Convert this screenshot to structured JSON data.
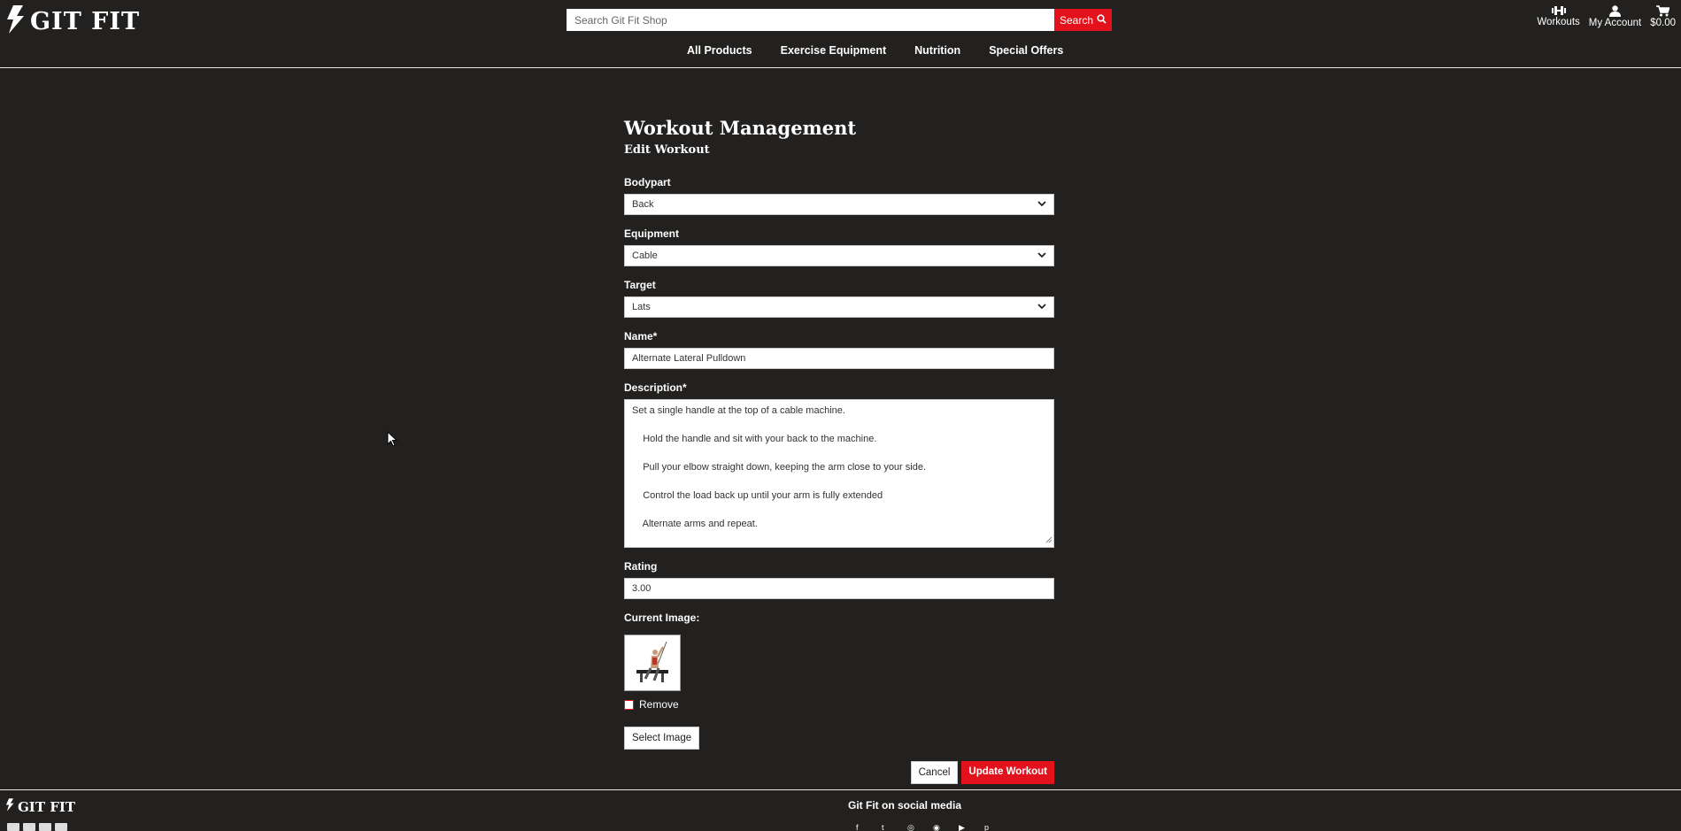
{
  "header": {
    "logo_text": "GIT FIT",
    "search": {
      "placeholder": "Search Git Fit Shop",
      "button_label": "Search"
    },
    "nav": [
      "All Products",
      "Exercise Equipment",
      "Nutrition",
      "Special Offers"
    ],
    "icons": [
      {
        "label": "Workouts",
        "icon": "dumbbell-icon"
      },
      {
        "label": "My Account",
        "icon": "user-icon"
      },
      {
        "label": "$0.00",
        "icon": "cart-icon"
      }
    ]
  },
  "form": {
    "title": "Workout Management",
    "subtitle": "Edit Workout",
    "bodypart": {
      "label": "Bodypart",
      "value": "Back"
    },
    "equipment": {
      "label": "Equipment",
      "value": "Cable"
    },
    "target": {
      "label": "Target",
      "value": "Lats"
    },
    "name": {
      "label": "Name*",
      "value": "Alternate Lateral Pulldown"
    },
    "description": {
      "label": "Description*",
      "lines": [
        "Set a single handle at the top of a cable machine.",
        "    Hold the handle and sit with your back to the machine.",
        "    Pull your elbow straight down, keeping the arm close to your side.",
        "    Control the load back up until your arm is fully extended",
        "    Alternate arms and repeat."
      ]
    },
    "rating": {
      "label": "Rating",
      "value": "3.00"
    },
    "current_image_label": "Current Image:",
    "remove_label": "Remove",
    "select_image_label": "Select Image",
    "cancel_label": "Cancel",
    "submit_label": "Update Workout"
  },
  "footer": {
    "logo_text": "GIT FIT",
    "social_title": "Git Fit on social media"
  },
  "colors": {
    "background": "#222120",
    "accent": "#e2111b",
    "text": "#ffffff"
  }
}
